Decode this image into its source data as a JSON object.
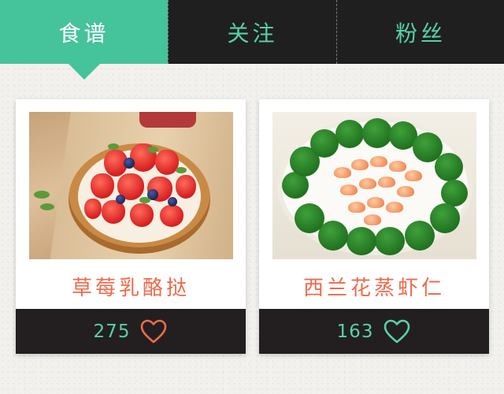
{
  "tabs": [
    {
      "label": "食谱",
      "active": true
    },
    {
      "label": "关注",
      "active": false
    },
    {
      "label": "粉丝",
      "active": false
    }
  ],
  "recipes": [
    {
      "title": "草莓乳酪挞",
      "likes": "275",
      "image": "strawberry-tart-photo",
      "heart_color": "#ee6a4c"
    },
    {
      "title": "西兰花蒸虾仁",
      "likes": "163",
      "image": "broccoli-shrimp-photo",
      "heart_color": "#56d1a6"
    }
  ],
  "colors": {
    "accent_green": "#45c39a",
    "text_green": "#56d1a6",
    "title_orange": "#ee6a4c",
    "dark": "#1f1f1f"
  }
}
